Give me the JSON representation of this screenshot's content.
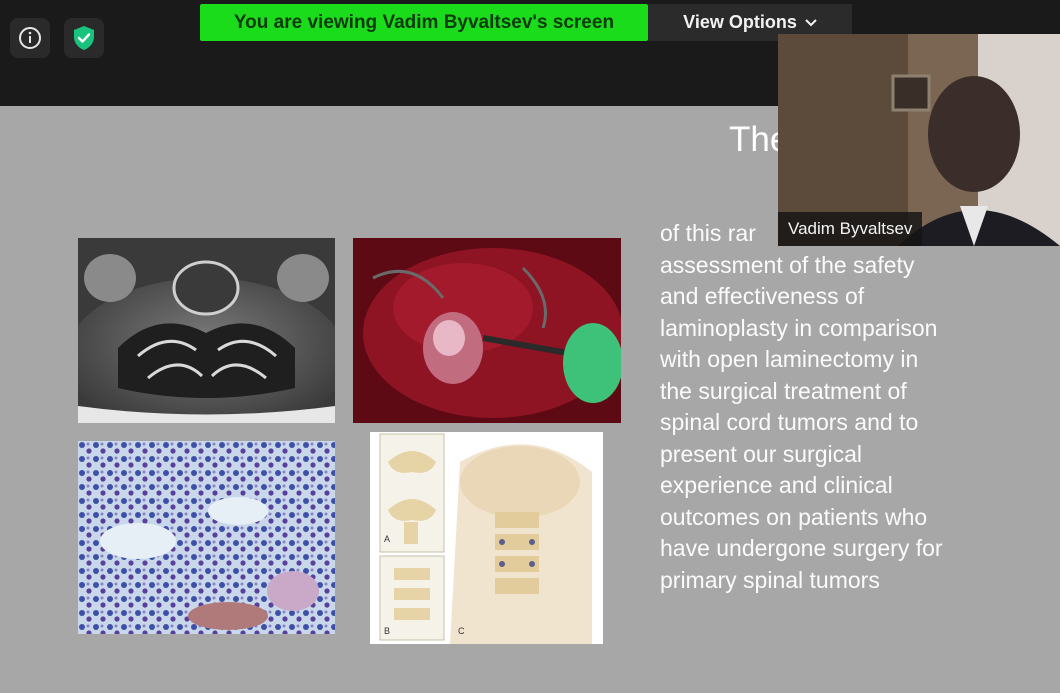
{
  "banner": {
    "text": "You are viewing Vadim Byvaltsev's screen"
  },
  "view_options": {
    "label": "View Options"
  },
  "icons": {
    "info": "info-icon",
    "shield": "shield-check-icon",
    "chevron": "chevron-down-icon"
  },
  "colors": {
    "banner_bg": "#1bdc1b",
    "shield": "#19c37d",
    "slide_bg": "#a7a7a7"
  },
  "slide": {
    "title_fragment": "The",
    "body_lines": [
      "of this rar",
      "assessment of the safety",
      "and effectiveness of",
      "laminoplasty in comparison",
      "with open laminectomy in",
      "the surgical treatment of",
      "spinal cord tumors and to",
      "present our surgical",
      "experience and clinical",
      "outcomes on patients who",
      "have undergone surgery for",
      "primary spinal tumors"
    ],
    "figure_labels": {
      "a": "A",
      "b": "B",
      "c": "C"
    }
  },
  "participant": {
    "name": "Vadim Byvaltsev"
  }
}
